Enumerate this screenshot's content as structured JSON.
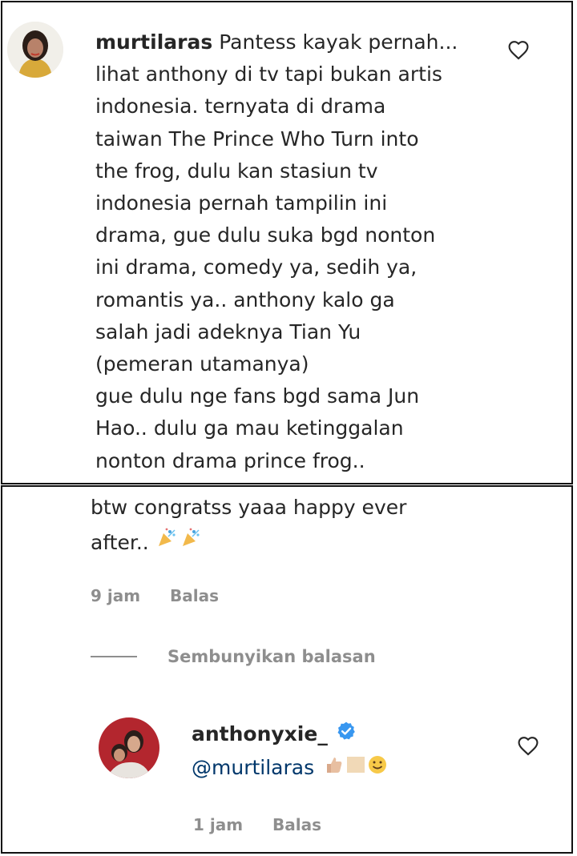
{
  "comment": {
    "username": "murtilaras",
    "lines": [
      "Pantess kayak pernah...",
      "lihat anthony di tv tapi bukan artis",
      "indonesia. ternyata di drama",
      "taiwan The Prince Who Turn into",
      "the frog, dulu kan stasiun tv",
      "indonesia pernah tampilin ini",
      "drama, gue dulu suka bgd nonton",
      "ini drama, comedy ya, sedih ya,",
      "romantis ya.. anthony kalo ga",
      "salah jadi adeknya Tian Yu",
      "(pemeran utamanya)",
      "gue dulu nge fans bgd sama Jun",
      "Hao.. dulu ga mau ketinggalan",
      "nonton drama prince frog.."
    ],
    "continuation_line1": "btw congratss yaaa happy ever",
    "continuation_line2": "after..",
    "time": "9 jam",
    "reply_label": "Balas",
    "hide_replies_label": "Sembunyikan balasan"
  },
  "reply": {
    "username": "anthonyxie_",
    "mention": "@murtilaras",
    "time": "1 jam",
    "reply_label": "Balas"
  },
  "colors": {
    "text": "#262626",
    "muted": "#8e8e8e",
    "link": "#00376b",
    "verified": "#3897f0"
  },
  "icons": {
    "like": "heart-outline-icon",
    "verified": "verified-badge-icon",
    "party": "party-popper-icon",
    "thumbs": "thumbs-up-icon",
    "smile": "smile-icon"
  }
}
